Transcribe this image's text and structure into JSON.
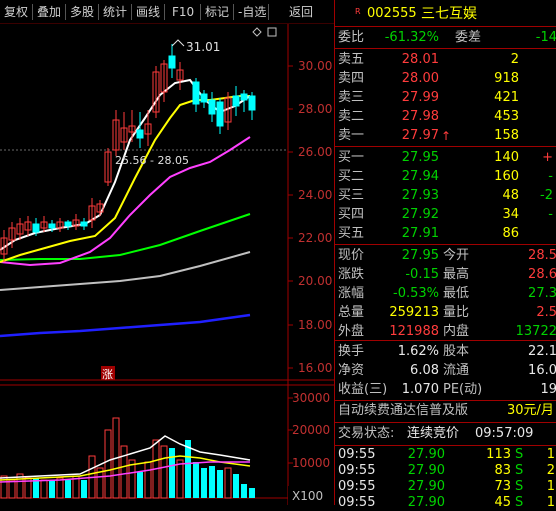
{
  "toolbar": {
    "items": [
      "复权",
      "叠加",
      "多股",
      "统计",
      "画线",
      "F10",
      "标记",
      "-自选",
      "返回"
    ]
  },
  "chart": {
    "annotation_high": "31.01",
    "annotation_range": "25.56 - 28.05",
    "price_axis": [
      "30.00",
      "28.00",
      "26.00",
      "24.00",
      "22.00",
      "20.00",
      "18.00",
      "16.00"
    ],
    "volume_axis": [
      "30000",
      "20000",
      "10000"
    ],
    "volume_unit": "X100",
    "marker_label": "涨",
    "colors": {
      "up": "#ff3c3c",
      "down": "#00ffff",
      "ma5": "#ffffff",
      "ma10": "#ffff00",
      "ma20": "#ff40ff",
      "ma30": "#00ff00",
      "ma60": "#c0c0c0",
      "ma120": "#2020ff"
    }
  },
  "quote": {
    "code": "002555",
    "name": "三七互娱",
    "r_badge": "R",
    "weibi_label": "委比",
    "weibi_value": "-61.32%",
    "weicha_label": "委差",
    "weicha_value": "-14",
    "sell": [
      {
        "label": "卖五",
        "price": "28.01",
        "vol": "2",
        "arrow": ""
      },
      {
        "label": "卖四",
        "price": "28.00",
        "vol": "918",
        "arrow": ""
      },
      {
        "label": "卖三",
        "price": "27.99",
        "vol": "421",
        "arrow": ""
      },
      {
        "label": "卖二",
        "price": "27.98",
        "vol": "453",
        "arrow": ""
      },
      {
        "label": "卖一",
        "price": "27.97",
        "vol": "158",
        "arrow": "↑"
      }
    ],
    "buy": [
      {
        "label": "买一",
        "price": "27.95",
        "vol": "140",
        "chg": "+"
      },
      {
        "label": "买二",
        "price": "27.94",
        "vol": "160",
        "chg": "-"
      },
      {
        "label": "买三",
        "price": "27.93",
        "vol": "48",
        "chg": "-2"
      },
      {
        "label": "买四",
        "price": "27.92",
        "vol": "34",
        "chg": "-"
      },
      {
        "label": "买五",
        "price": "27.91",
        "vol": "86",
        "chg": ""
      }
    ],
    "stats": [
      {
        "l1": "现价",
        "v1": "27.95",
        "l2": "今开",
        "v2": "28.5"
      },
      {
        "l1": "涨跌",
        "v1": "-0.15",
        "l2": "最高",
        "v2": "28.6"
      },
      {
        "l1": "涨幅",
        "v1": "-0.53%",
        "l2": "最低",
        "v2": "27.3"
      },
      {
        "l1": "总量",
        "v1": "259213",
        "l2": "量比",
        "v2": "2.5"
      },
      {
        "l1": "外盘",
        "v1": "121988",
        "l2": "内盘",
        "v2": "13722"
      }
    ],
    "stats2": [
      {
        "l1": "换手",
        "v1": "1.62%",
        "l2": "股本",
        "v2": "22.1"
      },
      {
        "l1": "净资",
        "v1": "6.08",
        "l2": "流通",
        "v2": "16.0"
      },
      {
        "l1": "收益(三)",
        "v1": "1.070",
        "l2": "PE(动)",
        "v2": "19"
      }
    ],
    "ad_text": "自动续费通达信普及版",
    "ad_price": "30元/月",
    "status_label": "交易状态:",
    "status_value": "连续竞价",
    "status_time": "09:57:09",
    "ticks": [
      {
        "time": "09:55",
        "price": "27.90",
        "vol": "113",
        "flag": "S",
        "n": "1"
      },
      {
        "time": "09:55",
        "price": "27.90",
        "vol": "83",
        "flag": "S",
        "n": "2"
      },
      {
        "time": "09:55",
        "price": "27.90",
        "vol": "73",
        "flag": "S",
        "n": "1"
      },
      {
        "time": "09:55",
        "price": "27.90",
        "vol": "45",
        "flag": "S",
        "n": "1"
      }
    ]
  }
}
